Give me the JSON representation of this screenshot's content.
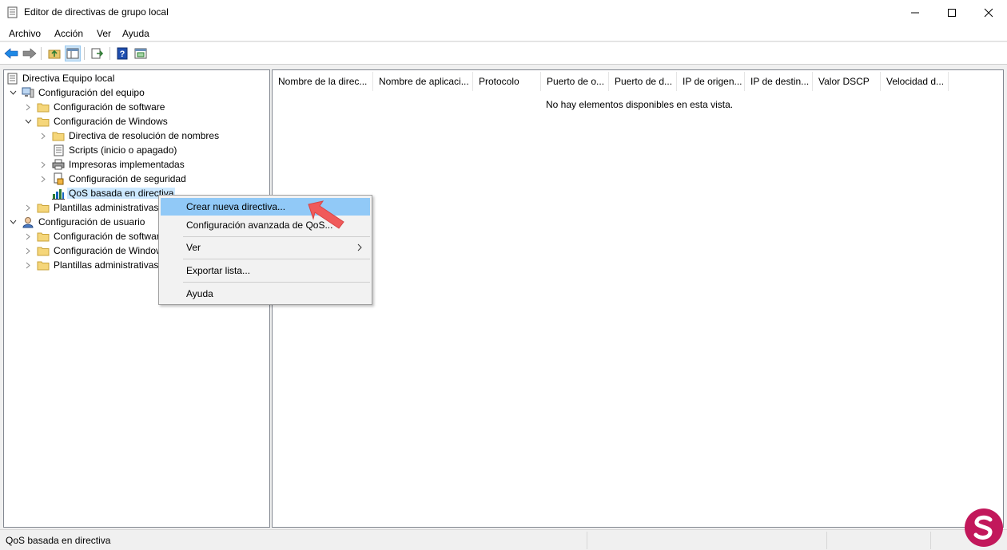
{
  "window": {
    "title": "Editor de directivas de grupo local"
  },
  "menubar": {
    "items": [
      "Archivo",
      "Acción",
      "Ver",
      "Ayuda"
    ]
  },
  "tree": {
    "items": [
      {
        "label": "Directiva Equipo local"
      },
      {
        "label": "Configuración del equipo"
      },
      {
        "label": "Configuración de software"
      },
      {
        "label": "Configuración de Windows"
      },
      {
        "label": "Directiva de resolución de nombres"
      },
      {
        "label": "Scripts (inicio o apagado)"
      },
      {
        "label": "Impresoras implementadas"
      },
      {
        "label": "Configuración de seguridad"
      },
      {
        "label": "QoS basada en directiva"
      },
      {
        "label": "Plantillas administrativas"
      },
      {
        "label": "Configuración de usuario"
      },
      {
        "label": "Configuración de software"
      },
      {
        "label": "Configuración de Windows"
      },
      {
        "label": "Plantillas administrativas"
      }
    ]
  },
  "list": {
    "columns": [
      "Nombre de la direc...",
      "Nombre de aplicaci...",
      "Protocolo",
      "Puerto de o...",
      "Puerto de d...",
      "IP de origen...",
      "IP de destin...",
      "Valor DSCP",
      "Velocidad d..."
    ],
    "empty_message": "No hay elementos disponibles en esta vista."
  },
  "context_menu": {
    "items": [
      {
        "label": "Crear nueva directiva..."
      },
      {
        "label": "Configuración avanzada de QoS..."
      },
      {
        "label": "Ver"
      },
      {
        "label": "Exportar lista..."
      },
      {
        "label": "Ayuda"
      }
    ]
  },
  "status": {
    "text": "QoS basada en directiva"
  },
  "colors": {
    "highlight": "#91c9f7",
    "selection": "#cce8ff",
    "arrow": "#f05a5a",
    "logo": "#c2185b"
  },
  "icons": [
    "back-arrow-icon",
    "forward-arrow-icon",
    "up-folder-icon",
    "show-hide-tree-icon",
    "export-list-icon",
    "help-icon",
    "properties-icon",
    "minimize-icon",
    "maximize-icon",
    "close-icon",
    "folder-icon",
    "computer-icon",
    "user-icon",
    "scroll-icon",
    "printer-icon",
    "security-icon",
    "qos-chart-icon",
    "chevron-right-icon",
    "chevron-down-icon"
  ]
}
